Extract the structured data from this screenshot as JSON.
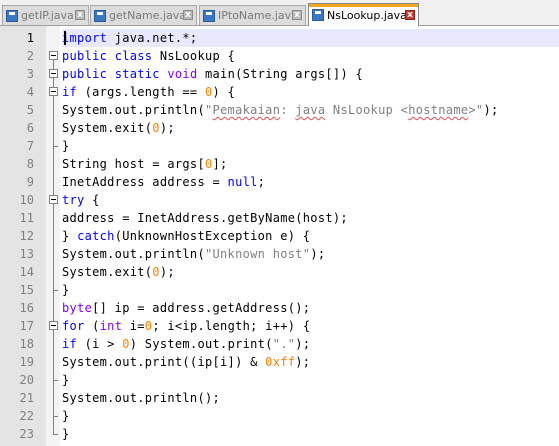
{
  "tabs": [
    {
      "label": "getIP.java",
      "active": false,
      "icon": "java-file-icon"
    },
    {
      "label": "getName.java",
      "active": false,
      "icon": "java-file-icon"
    },
    {
      "label": "IPtoName.java",
      "active": false,
      "icon": "java-file-icon"
    },
    {
      "label": "NsLookup.java",
      "active": true,
      "icon": "java-file-icon"
    }
  ],
  "tab_close_glyph": "x",
  "editor": {
    "current_line": 1,
    "colors": {
      "keyword": "#0000ff",
      "type": "#8000ff",
      "string": "#808080",
      "number": "#ff8000",
      "current_line_bg": "#e8e8ff",
      "active_tab_accent": "#f6a623"
    },
    "lines": [
      {
        "n": "1",
        "fold": "none",
        "tokens": [
          {
            "t": "import",
            "c": "kw"
          },
          {
            "t": " java.net.*;"
          }
        ]
      },
      {
        "n": "2",
        "fold": "begin",
        "tokens": [
          {
            "t": "public",
            "c": "kw"
          },
          {
            "t": " "
          },
          {
            "t": "class",
            "c": "kw"
          },
          {
            "t": " NsLookup {"
          }
        ]
      },
      {
        "n": "3",
        "fold": "begin",
        "tokens": [
          {
            "t": "public",
            "c": "kw"
          },
          {
            "t": " "
          },
          {
            "t": "static",
            "c": "kw"
          },
          {
            "t": " "
          },
          {
            "t": "void",
            "c": "typ"
          },
          {
            "t": " main(String args[]) {"
          }
        ]
      },
      {
        "n": "4",
        "fold": "begin",
        "tokens": [
          {
            "t": "if",
            "c": "kw"
          },
          {
            "t": " (args.length == "
          },
          {
            "t": "0",
            "c": "num-lit"
          },
          {
            "t": ") {"
          }
        ]
      },
      {
        "n": "5",
        "fold": "line",
        "tokens": [
          {
            "t": "System.out.println("
          },
          {
            "t": "\"",
            "c": "str"
          },
          {
            "t": "Pemakaian",
            "c": "str squig"
          },
          {
            "t": ": ",
            "c": "str"
          },
          {
            "t": "java",
            "c": "str squig"
          },
          {
            "t": " NsLookup <",
            "c": "str"
          },
          {
            "t": "hostname",
            "c": "str squig"
          },
          {
            "t": ">\"",
            "c": "str"
          },
          {
            "t": ");"
          }
        ]
      },
      {
        "n": "6",
        "fold": "line",
        "tokens": [
          {
            "t": "System.exit("
          },
          {
            "t": "0",
            "c": "num-lit"
          },
          {
            "t": ");"
          }
        ]
      },
      {
        "n": "7",
        "fold": "end",
        "tokens": [
          {
            "t": "}"
          }
        ]
      },
      {
        "n": "8",
        "fold": "line",
        "tokens": [
          {
            "t": "String host = args["
          },
          {
            "t": "0",
            "c": "num-lit"
          },
          {
            "t": "];"
          }
        ]
      },
      {
        "n": "9",
        "fold": "line",
        "tokens": [
          {
            "t": "InetAddress address = "
          },
          {
            "t": "null",
            "c": "kw"
          },
          {
            "t": ";"
          }
        ]
      },
      {
        "n": "10",
        "fold": "begin",
        "tokens": [
          {
            "t": "try",
            "c": "kw"
          },
          {
            "t": " {"
          }
        ]
      },
      {
        "n": "11",
        "fold": "line",
        "tokens": [
          {
            "t": "address = InetAddress.getByName(host);"
          }
        ]
      },
      {
        "n": "12",
        "fold": "line",
        "tokens": [
          {
            "t": "} "
          },
          {
            "t": "catch",
            "c": "kw"
          },
          {
            "t": "(UnknownHostException e) {"
          }
        ]
      },
      {
        "n": "13",
        "fold": "line",
        "tokens": [
          {
            "t": "System.out.println("
          },
          {
            "t": "\"Unknown host\"",
            "c": "str"
          },
          {
            "t": ");"
          }
        ]
      },
      {
        "n": "14",
        "fold": "line",
        "tokens": [
          {
            "t": "System.exit("
          },
          {
            "t": "0",
            "c": "num-lit"
          },
          {
            "t": ");"
          }
        ]
      },
      {
        "n": "15",
        "fold": "end",
        "tokens": [
          {
            "t": "}"
          }
        ]
      },
      {
        "n": "16",
        "fold": "line",
        "tokens": [
          {
            "t": "byte",
            "c": "typ"
          },
          {
            "t": "[] ip = address.getAddress();"
          }
        ]
      },
      {
        "n": "17",
        "fold": "begin",
        "tokens": [
          {
            "t": "for",
            "c": "kw"
          },
          {
            "t": " ("
          },
          {
            "t": "int",
            "c": "typ"
          },
          {
            "t": " i="
          },
          {
            "t": "0",
            "c": "num-lit"
          },
          {
            "t": "; i<ip.length; i++) {"
          }
        ]
      },
      {
        "n": "18",
        "fold": "line",
        "tokens": [
          {
            "t": "if",
            "c": "kw"
          },
          {
            "t": " (i > "
          },
          {
            "t": "0",
            "c": "num-lit"
          },
          {
            "t": ") System.out.print("
          },
          {
            "t": "\".\"",
            "c": "str"
          },
          {
            "t": ");"
          }
        ]
      },
      {
        "n": "19",
        "fold": "line",
        "tokens": [
          {
            "t": "System.out.print((ip[i]) & "
          },
          {
            "t": "0xff",
            "c": "num-lit"
          },
          {
            "t": ");"
          }
        ]
      },
      {
        "n": "20",
        "fold": "end",
        "tokens": [
          {
            "t": "}"
          }
        ]
      },
      {
        "n": "21",
        "fold": "line",
        "tokens": [
          {
            "t": "System.out.println();"
          }
        ]
      },
      {
        "n": "22",
        "fold": "end",
        "tokens": [
          {
            "t": "}"
          }
        ]
      },
      {
        "n": "23",
        "fold": "endlast",
        "tokens": [
          {
            "t": "}"
          }
        ]
      }
    ]
  }
}
